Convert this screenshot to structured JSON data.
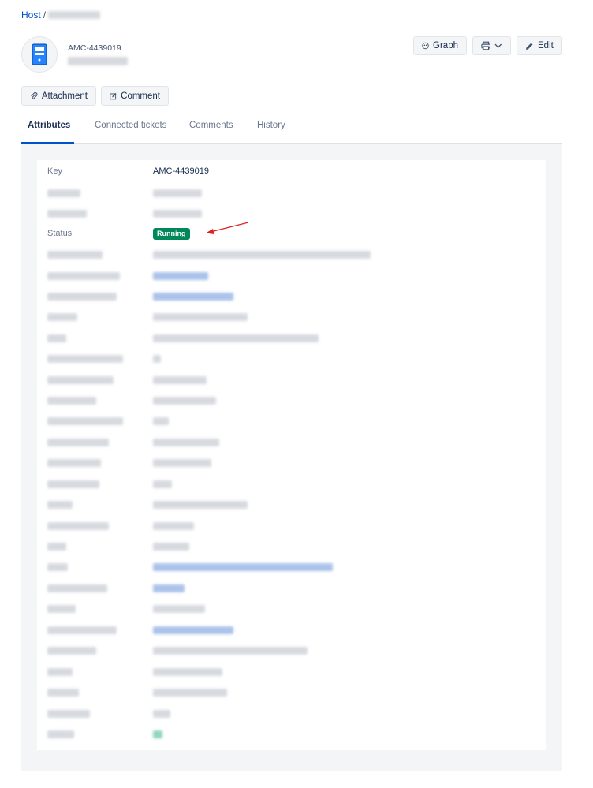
{
  "breadcrumb": {
    "root": "Host",
    "separator": "/"
  },
  "header": {
    "object_key": "AMC-4439019"
  },
  "actions": {
    "graph_label": "Graph",
    "edit_label": "Edit"
  },
  "toolbar": {
    "attachment_label": "Attachment",
    "comment_label": "Comment"
  },
  "tabs": [
    {
      "label": "Attributes",
      "active": true
    },
    {
      "label": "Connected tickets",
      "active": false
    },
    {
      "label": "Comments",
      "active": false
    },
    {
      "label": "History",
      "active": false
    }
  ],
  "attributes": {
    "key_label": "Key",
    "key_value": "AMC-4439019",
    "status_label": "Status",
    "status_value": "Running"
  },
  "colors": {
    "accent": "#0052cc",
    "status": "#00875a",
    "annotation_arrow": "#e02020"
  },
  "icons": {
    "avatar": "server-icon",
    "graph": "graph-icon",
    "print": "printer-icon",
    "dropdown": "chevron-down-icon",
    "edit": "pencil-icon",
    "attachment": "paperclip-icon",
    "comment": "comment-icon"
  }
}
